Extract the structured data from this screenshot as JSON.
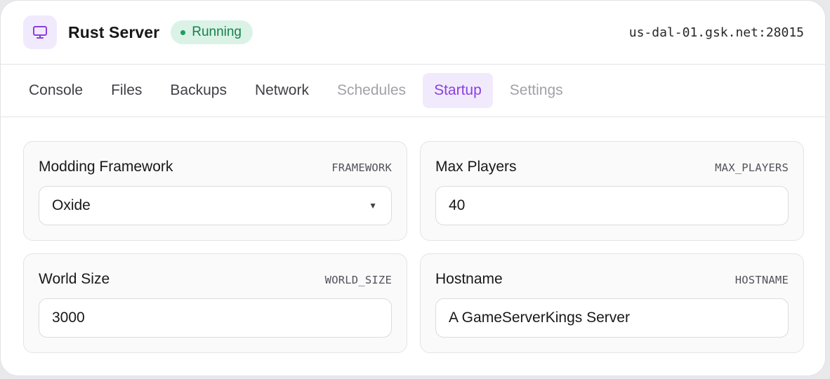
{
  "header": {
    "title": "Rust Server",
    "status": "Running",
    "address": "us-dal-01.gsk.net:28015",
    "icon": "monitor-icon",
    "accent": "#8b3fe0"
  },
  "tabs": [
    {
      "label": "Console",
      "state": "normal"
    },
    {
      "label": "Files",
      "state": "normal"
    },
    {
      "label": "Backups",
      "state": "normal"
    },
    {
      "label": "Network",
      "state": "normal"
    },
    {
      "label": "Schedules",
      "state": "disabled"
    },
    {
      "label": "Startup",
      "state": "active"
    },
    {
      "label": "Settings",
      "state": "disabled"
    }
  ],
  "startup": {
    "framework": {
      "label": "Modding Framework",
      "variable": "FRAMEWORK",
      "value": "Oxide"
    },
    "max_players": {
      "label": "Max Players",
      "variable": "MAX_PLAYERS",
      "value": "40"
    },
    "world_size": {
      "label": "World Size",
      "variable": "WORLD_SIZE",
      "value": "3000"
    },
    "hostname": {
      "label": "Hostname",
      "variable": "HOSTNAME",
      "value": "A GameServerKings Server"
    }
  }
}
